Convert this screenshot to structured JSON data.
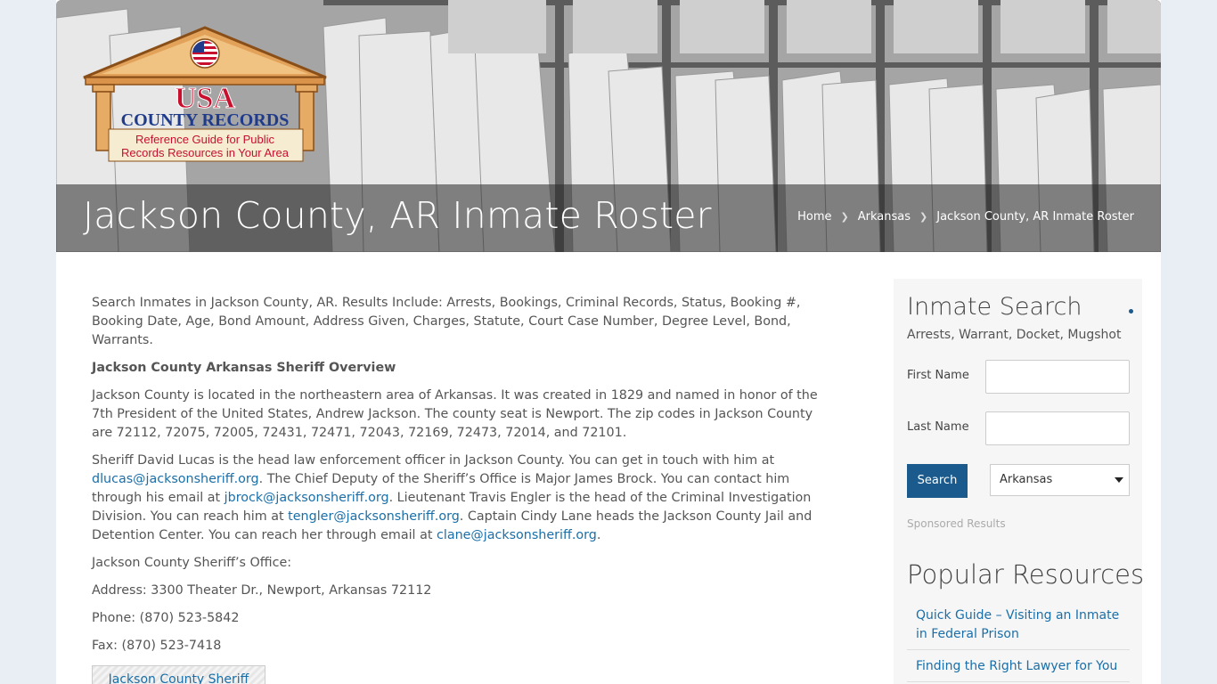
{
  "header": {
    "page_title": "Jackson County, AR Inmate Roster",
    "breadcrumb": [
      "Home",
      "Arkansas",
      "Jackson County, AR Inmate Roster"
    ]
  },
  "logo": {
    "line1": "USA",
    "line2": "COUNTY RECORDS",
    "tagline1": "Reference Guide for Public",
    "tagline2": "Records Resources in Your Area"
  },
  "main": {
    "intro": "Search Inmates in Jackson County, AR. Results Include: Arrests, Bookings, Criminal Records, Status, Booking #, Booking Date, Age, Bond Amount, Address Given, Charges, Statute, Court Case Number, Degree Level, Bond, Warrants.",
    "overview_heading": "Jackson  County Arkansas Sheriff Overview",
    "overview_text": "Jackson County is located in the northeastern area of Arkansas. It was created in 1829 and named in honor of the 7th President of the United States, Andrew Jackson. The county seat is Newport. The zip codes in Jackson County are 72112, 72075, 72005, 72431, 72471, 72043, 72169, 72473, 72014, and 72101.",
    "sheriff_p": {
      "t1": "Sheriff David Lucas is the head law enforcement officer in Jackson County. You can get in touch with him at ",
      "email1": "dlucas@jacksonsheriff.org",
      "t2": ". The Chief Deputy of the Sheriff’s Office is Major James Brock. You can contact him through his email at ",
      "email2": "jbrock@jacksonsheriff.org",
      "t3": ". Lieutenant Travis Engler is the  head of the Criminal Investigation Division. You can reach him at ",
      "email3": "tengler@jacksonsheriff.org",
      "t4": ". Captain Cindy Lane heads the Jackson County Jail and Detention Center. You can reach her through email at ",
      "email4": "clane@jacksonsheriff.org",
      "t5": "."
    },
    "office_label": "Jackson  County Sheriff’s Office:",
    "address": "Address: 3300 Theater Dr., Newport, Arkansas 72112",
    "phone": "Phone: (870) 523-5842",
    "fax": "Fax: (870) 523-7418",
    "sheriff_button": "Jackson County Sheriff"
  },
  "sidebar": {
    "title": "Inmate Search",
    "subtitle": "Arrests, Warrant, Docket, Mugshot",
    "first_name_label": "First Name",
    "last_name_label": "Last Name",
    "search_button": "Search",
    "state_selected": "Arkansas",
    "sponsored": "Sponsored Results",
    "popular_title": "Popular Resources",
    "resources": [
      "Quick Guide – Visiting an Inmate in Federal Prison",
      "Finding the Right Lawyer for You"
    ]
  },
  "colors": {
    "accent": "#1a5a8c",
    "link": "#1a6fa8",
    "background": "#e8eef3"
  }
}
